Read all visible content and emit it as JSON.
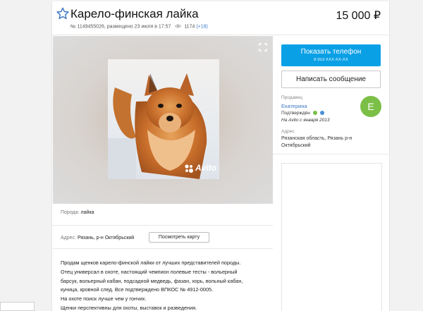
{
  "listing": {
    "title": "Карело-финская лайка",
    "meta_number": "№ 1149455026, размещено 23 июля в 17:57",
    "views": "1174",
    "views_delta": "(+18)",
    "price": "15 000 ₽"
  },
  "photo": {
    "watermark": "Avito",
    "expand_icon": "expand-icon"
  },
  "details": {
    "breed_label": "Порода:",
    "breed_value": "лайка",
    "address_label": "Адрес:",
    "address_value": "Рязань, р-н Октябрьский",
    "map_button": "Посмотреть карту"
  },
  "description": {
    "lines": [
      "Продам щенков карело-финской лайки от лучших представителей породы.",
      "Отец универсал в охоте, настоящий чемпион полевые тесты - вольерный",
      "барсук, вольерный кабан, подсадной медведь, фазан, хорь, вольный кабан,",
      "куница, кровной след. Все подтверждено ВПКОС № 4912-0005.",
      "На охоте поиск лучше чем у гончих.",
      "Щенки перспективны для охоты, выставок и разведения."
    ]
  },
  "sidebar": {
    "phone_button": "Показать телефон",
    "phone_masked": "8 953 XXX-XX-XX",
    "message_button": "Написать сообщение",
    "seller_label": "Продавец",
    "seller_name": "Екатерина",
    "confirmed": "Подтверждён",
    "since": "На Avito с января 2013",
    "avatar_letter": "E",
    "address_label": "Адрес",
    "address_value": "Рязанская область, Рязань р-н Октябрьский"
  },
  "colors": {
    "accent_blue": "#0aa0e6",
    "link_blue": "#3d78c5",
    "avatar_green": "#7bbf47"
  }
}
